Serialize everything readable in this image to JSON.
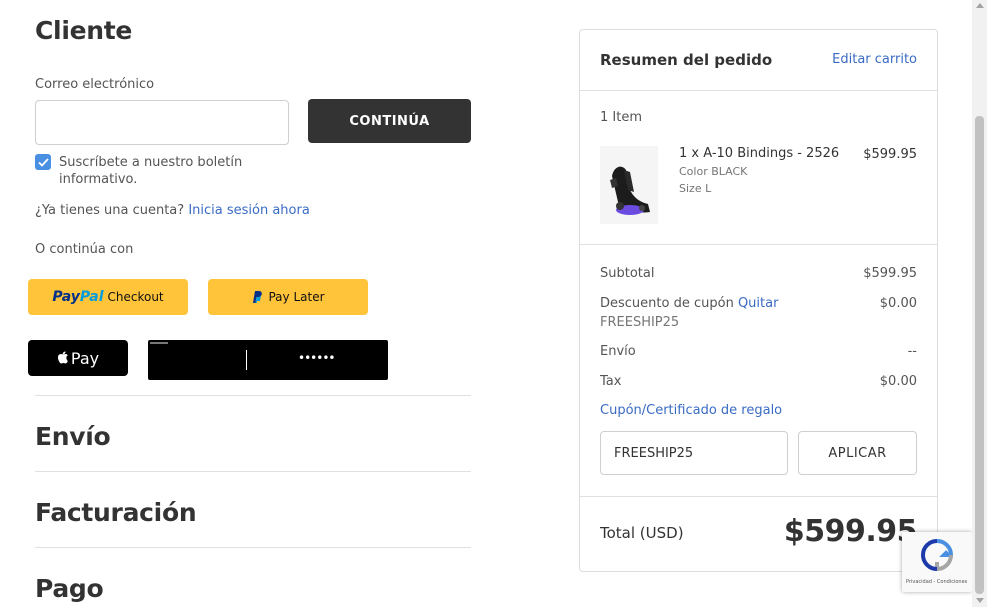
{
  "customer": {
    "title": "Cliente",
    "email_label": "Correo electrónico",
    "email_value": "",
    "continue_label": "CONTINÚA",
    "newsletter_line1": "Suscríbete a nuestro boletín",
    "newsletter_line2": "informativo.",
    "account_question": "¿Ya tienes una cuenta?",
    "signin_link": "Inicia sesión ahora",
    "or_continue": "O continúa con",
    "paypal_pay": "Pay",
    "paypal_pal": "Pal",
    "paypal_checkout": "Checkout",
    "paylater_label": "Pay Later",
    "applepay_label": "Pay",
    "googlepay_dots": "••••••"
  },
  "sections": {
    "shipping": "Envío",
    "billing": "Facturación",
    "payment": "Pago"
  },
  "summary": {
    "title": "Resumen del pedido",
    "edit_cart": "Editar carrito",
    "item_count": "1 Item",
    "item_name": "1 x A-10 Bindings - 2526",
    "item_color": "Color BLACK",
    "item_size": "Size L",
    "item_price": "$599.95",
    "subtotal_label": "Subtotal",
    "subtotal_value": "$599.95",
    "coupon_label": "Descuento de cupón",
    "coupon_remove": "Quitar",
    "coupon_code": "FREESHIP25",
    "coupon_value": "$0.00",
    "shipping_label": "Envío",
    "shipping_value": "--",
    "tax_label": "Tax",
    "tax_value": "$0.00",
    "gift_link": "Cupón/Certificado de regalo",
    "coupon_input_value": "FREESHIP25",
    "apply_label": "APLICAR",
    "total_label": "Total (USD)",
    "total_value": "$599.95"
  },
  "recaptcha": {
    "footer": "Privacidad - Condiciones"
  },
  "colors": {
    "accent_link": "#3a6bc4",
    "dark_button": "#333333",
    "paypal_yellow": "#ffc439"
  }
}
